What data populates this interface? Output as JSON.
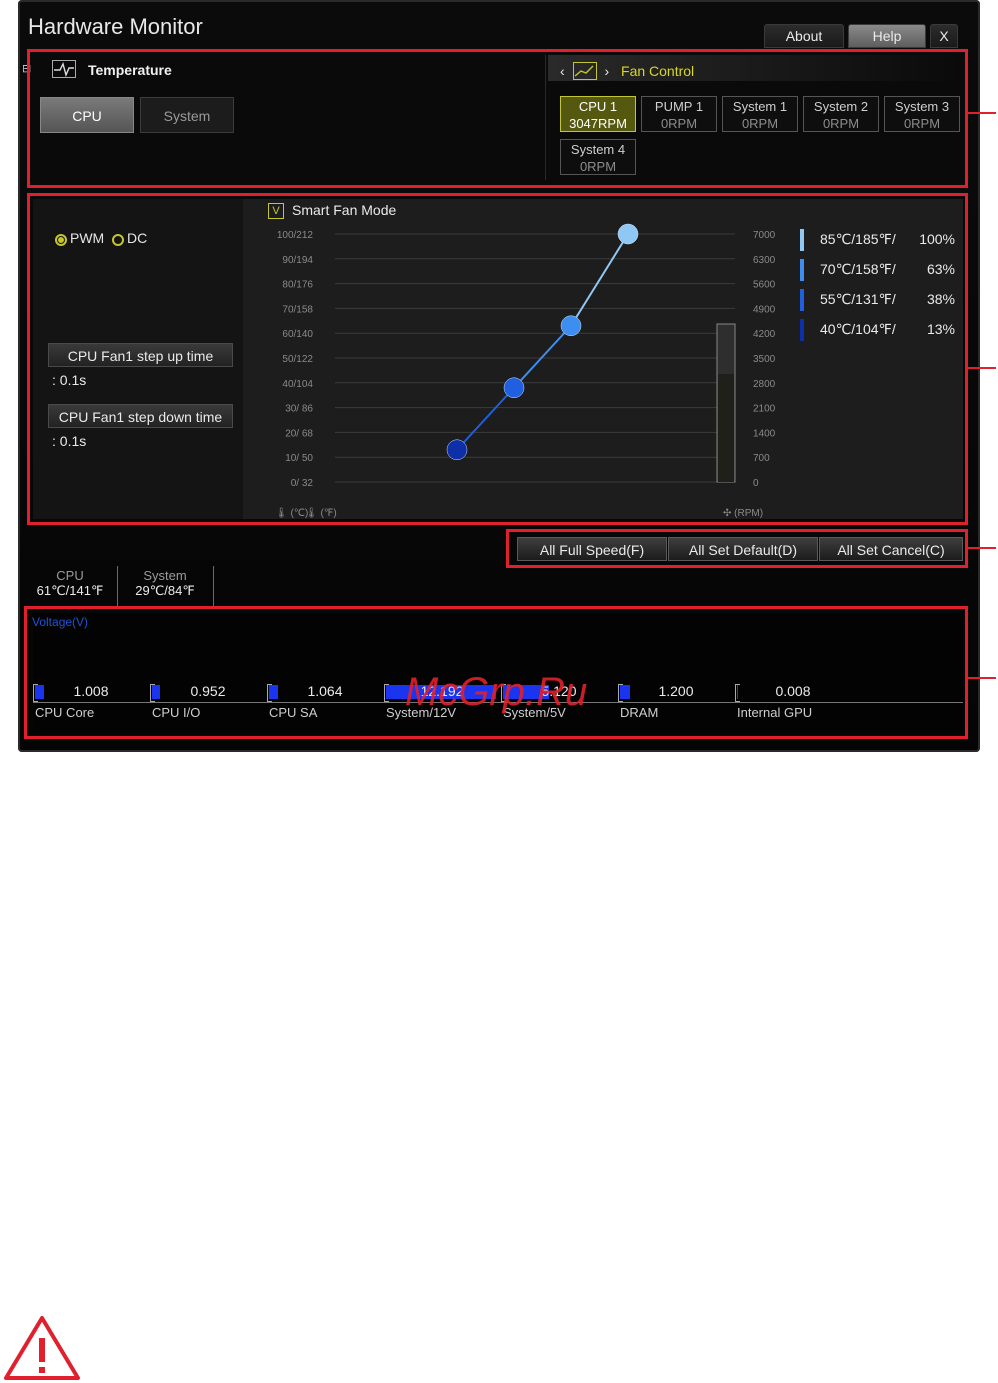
{
  "window": {
    "title": "Hardware Monitor",
    "about_label": "About",
    "help_label": "Help",
    "close_label": "X"
  },
  "temperature": {
    "heading": "Temperature",
    "sources": [
      "CPU",
      "System"
    ]
  },
  "fan_control": {
    "heading": "Fan Control",
    "fans": [
      {
        "name": "CPU 1",
        "rpm": "3047RPM"
      },
      {
        "name": "PUMP 1",
        "rpm": "0RPM"
      },
      {
        "name": "System 1",
        "rpm": "0RPM"
      },
      {
        "name": "System 2",
        "rpm": "0RPM"
      },
      {
        "name": "System 3",
        "rpm": "0RPM"
      },
      {
        "name": "System 4",
        "rpm": "0RPM"
      }
    ]
  },
  "mode": {
    "pwm": "PWM",
    "dc": "DC",
    "smart_fan_label": "Smart Fan Mode",
    "smart_check": "V"
  },
  "steps": {
    "up_label": "CPU Fan1 step up time",
    "up_value": ": 0.1s",
    "down_label": "CPU Fan1 step down time",
    "down_value": ": 0.1s"
  },
  "chart_data": {
    "type": "line",
    "x": [
      40,
      55,
      70,
      85
    ],
    "y": [
      13,
      38,
      63,
      100
    ],
    "y_ticks_left": [
      "100/212",
      "90/194",
      "80/176",
      "70/158",
      "60/140",
      "50/122",
      "40/104",
      "30/ 86",
      "20/ 68",
      "10/ 50",
      "0/ 32"
    ],
    "y_ticks_right": [
      "7000",
      "6300",
      "5600",
      "4900",
      "4200",
      "3500",
      "2800",
      "2100",
      "1400",
      "700",
      "0"
    ],
    "unit_c": "(℃)",
    "unit_f": "(℉)",
    "unit_rpm": "(RPM)",
    "current_rpm": 3047
  },
  "legend": [
    {
      "temp": "85℃/185℉/",
      "pct": "100%",
      "color": "#8fc8f5"
    },
    {
      "temp": "70℃/158℉/",
      "pct": "63%",
      "color": "#3d8ef0"
    },
    {
      "temp": "55℃/131℉/",
      "pct": "38%",
      "color": "#1f5fe0"
    },
    {
      "temp": "40℃/104℉/",
      "pct": "13%",
      "color": "#0d2fa8"
    }
  ],
  "actions": {
    "full_speed": "All Full Speed(F)",
    "set_default": "All Set Default(D)",
    "set_cancel": "All Set Cancel(C)"
  },
  "readouts": [
    {
      "name": "CPU",
      "value": "61℃/141℉"
    },
    {
      "name": "System",
      "value": "29℃/84℉"
    }
  ],
  "voltage": {
    "heading": "Voltage(V)",
    "items": [
      {
        "name": "CPU Core",
        "value": "1.008",
        "fill": 0.08
      },
      {
        "name": "CPU I/O",
        "value": "0.952",
        "fill": 0.07
      },
      {
        "name": "CPU SA",
        "value": "1.064",
        "fill": 0.08
      },
      {
        "name": "System/12V",
        "value": "12.192",
        "fill": 1.0
      },
      {
        "name": "System/5V",
        "value": "5.120",
        "fill": 0.42
      },
      {
        "name": "DRAM",
        "value": "1.200",
        "fill": 0.09
      },
      {
        "name": "Internal GPU",
        "value": "0.008",
        "fill": 0.0
      }
    ]
  },
  "watermark": "McGrp.Ru",
  "colors": {
    "accent": "#c4c630",
    "callout": "#e0202c",
    "volt": "#1a34f0"
  }
}
